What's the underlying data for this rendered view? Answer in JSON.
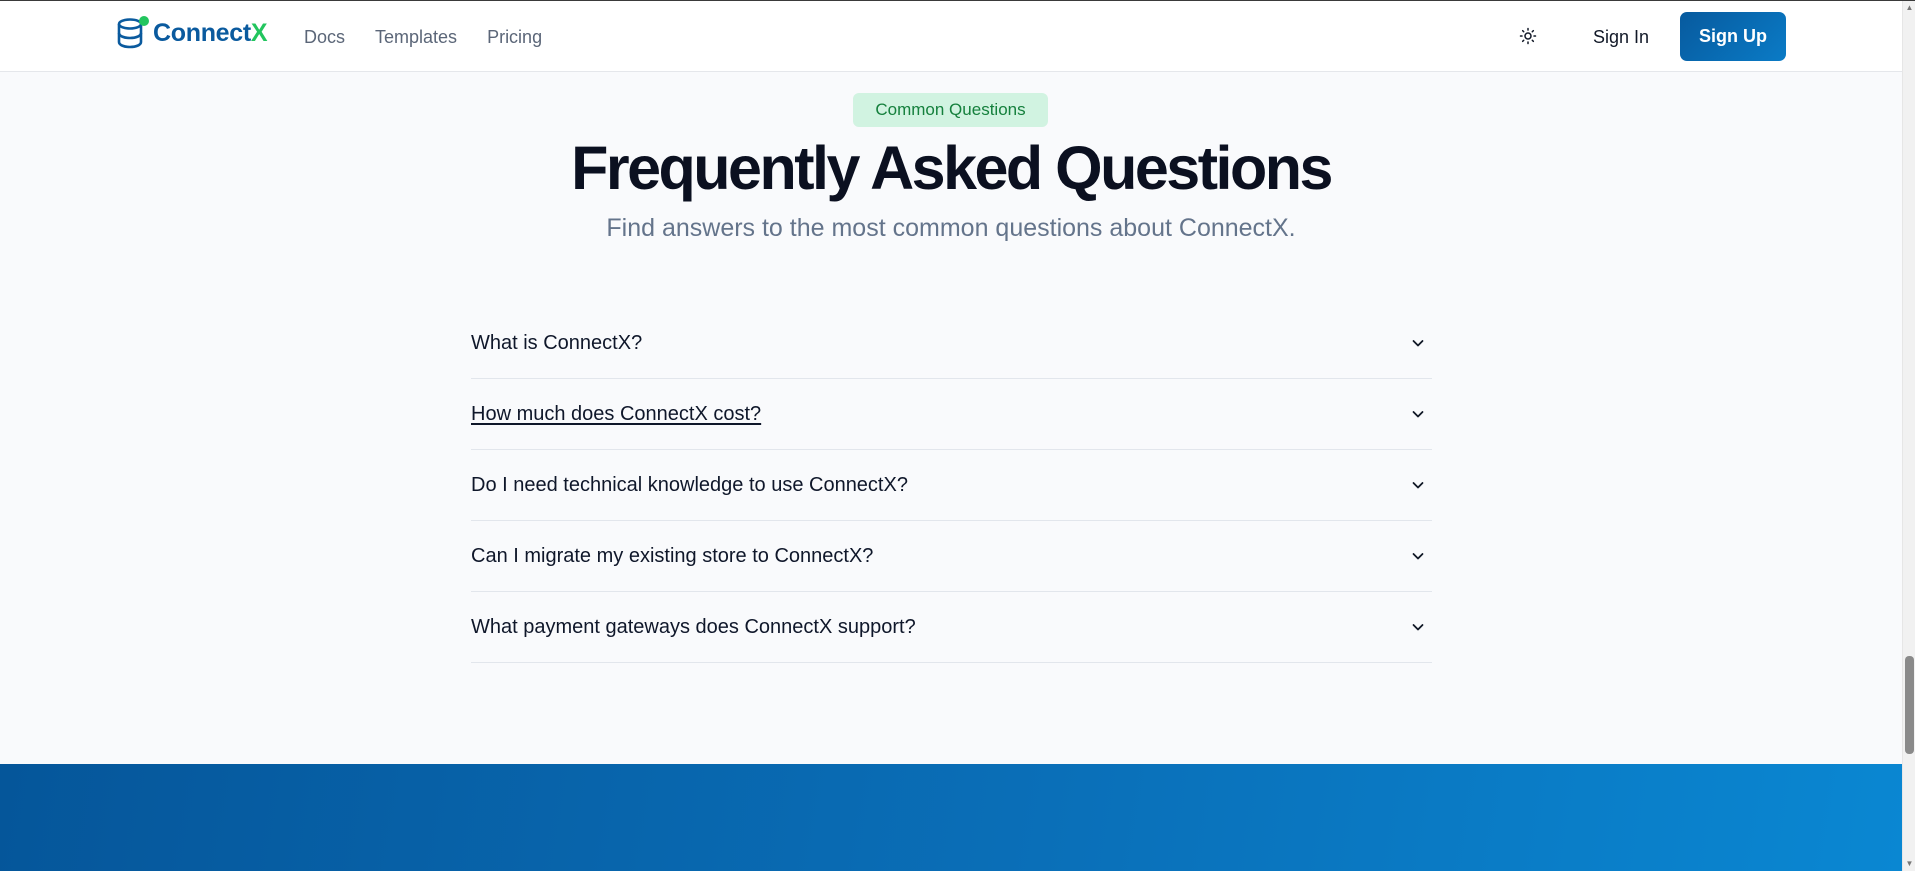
{
  "header": {
    "brand_main": "Connect",
    "brand_accent": "X",
    "nav": [
      "Docs",
      "Templates",
      "Pricing"
    ],
    "theme_icon": "sun-icon",
    "sign_in": "Sign In",
    "sign_up": "Sign Up"
  },
  "faq": {
    "badge": "Common Questions",
    "title": "Frequently Asked Questions",
    "subtitle": "Find answers to the most common questions about ConnectX.",
    "items": [
      {
        "question": "What is ConnectX?"
      },
      {
        "question": "How much does ConnectX cost?"
      },
      {
        "question": "Do I need technical knowledge to use ConnectX?"
      },
      {
        "question": "Can I migrate my existing store to ConnectX?"
      },
      {
        "question": "What payment gateways does ConnectX support?"
      }
    ],
    "chevron_icon": "chevron-down-icon"
  },
  "colors": {
    "brand_blue": "#0a5a9e",
    "accent_green": "#22c55e",
    "badge_bg": "#d1f3e1",
    "badge_text": "#15803d",
    "cta_start": "#05569a",
    "cta_end": "#0a87d2"
  }
}
